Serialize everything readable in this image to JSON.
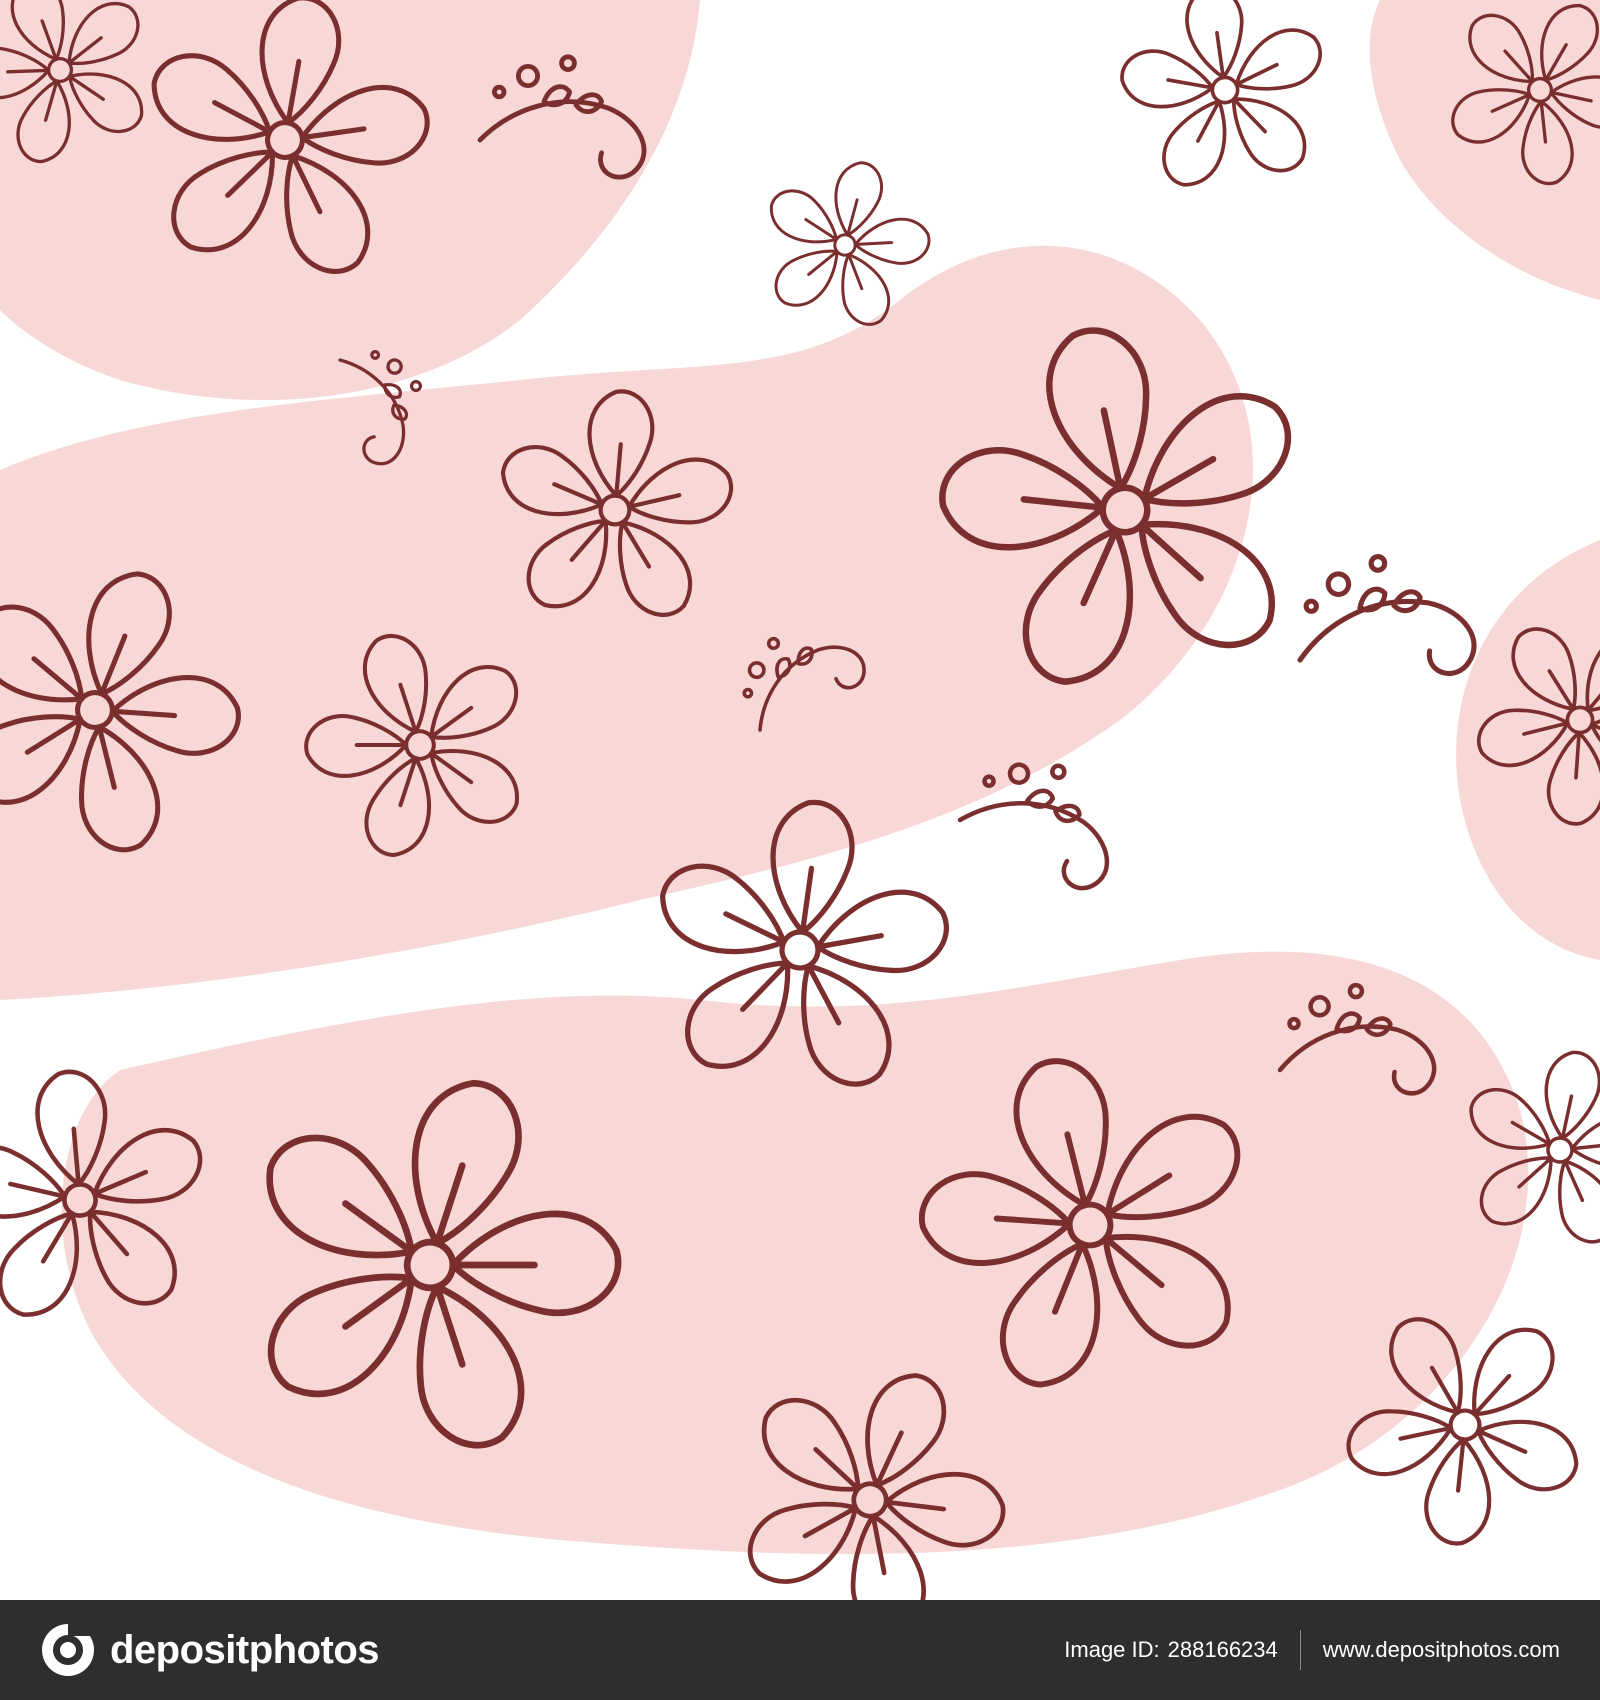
{
  "image": {
    "subject": "seamless floral pattern",
    "colors": {
      "background": "#ffffff",
      "blob": "#f8d7d7",
      "line": "#7a2e2e",
      "footer": "#2e2e2e",
      "footer_text": "#ffffff"
    }
  },
  "footer": {
    "brand": "depositphotos",
    "brand_icon": "depositphotos-logo-icon",
    "image_id_label": "Image ID:",
    "image_id": "288166234",
    "website": "www.depositphotos.com"
  }
}
